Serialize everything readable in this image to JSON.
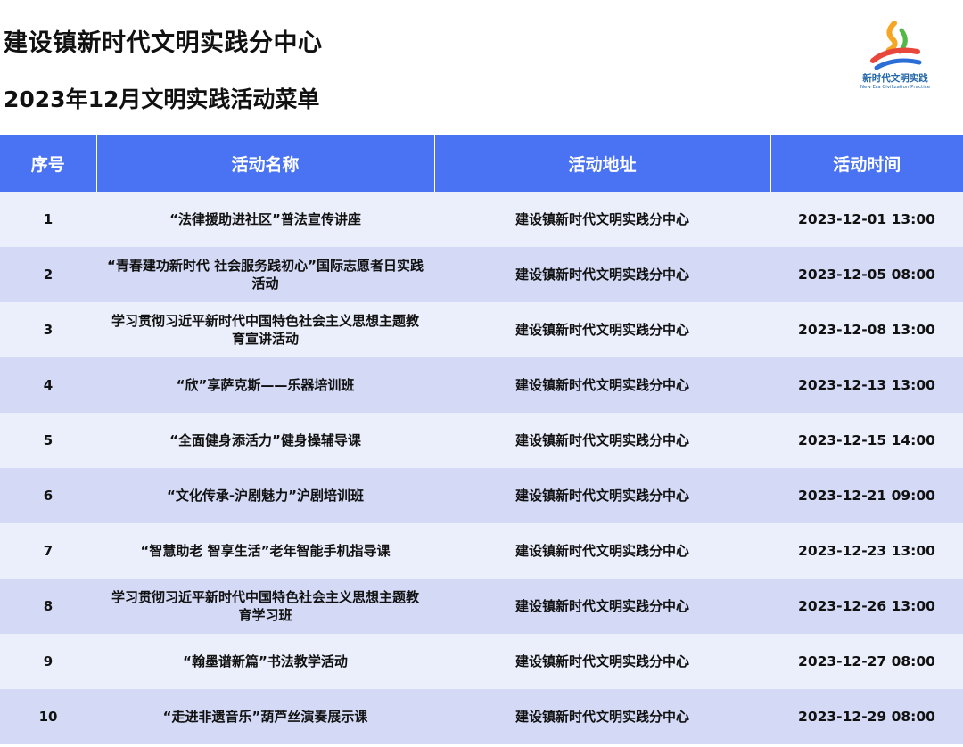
{
  "header": {
    "title": "建设镇新时代文明实践分中心",
    "subtitle": "2023年12月文明实践活动菜单"
  },
  "logo": {
    "text_cn": "新时代文明实践",
    "text_en": "New Era Civilization Practice",
    "colors": {
      "orange": "#f5a623",
      "red": "#e8483b",
      "blue": "#2b6fd6",
      "green": "#53b848"
    }
  },
  "table": {
    "columns": [
      "序号",
      "活动名称",
      "活动地址",
      "活动时间"
    ],
    "rows": [
      {
        "no": "1",
        "name": "“法律援助进社区”普法宣传讲座",
        "address": "建设镇新时代文明实践分中心",
        "time": "2023-12-01 13:00"
      },
      {
        "no": "2",
        "name": "“青春建功新时代 社会服务践初心”国际志愿者日实践活动",
        "address": "建设镇新时代文明实践分中心",
        "time": "2023-12-05 08:00"
      },
      {
        "no": "3",
        "name": "学习贯彻习近平新时代中国特色社会主义思想主题教育宣讲活动",
        "address": "建设镇新时代文明实践分中心",
        "time": "2023-12-08 13:00"
      },
      {
        "no": "4",
        "name": "“欣”享萨克斯——乐器培训班",
        "address": "建设镇新时代文明实践分中心",
        "time": "2023-12-13 13:00"
      },
      {
        "no": "5",
        "name": "“全面健身添活力”健身操辅导课",
        "address": "建设镇新时代文明实践分中心",
        "time": "2023-12-15 14:00"
      },
      {
        "no": "6",
        "name": "“文化传承-沪剧魅力”沪剧培训班",
        "address": "建设镇新时代文明实践分中心",
        "time": "2023-12-21 09:00"
      },
      {
        "no": "7",
        "name": "“智慧助老 智享生活”老年智能手机指导课",
        "address": "建设镇新时代文明实践分中心",
        "time": "2023-12-23 13:00"
      },
      {
        "no": "8",
        "name": "学习贯彻习近平新时代中国特色社会主义思想主题教育学习班",
        "address": "建设镇新时代文明实践分中心",
        "time": "2023-12-26 13:00"
      },
      {
        "no": "9",
        "name": "“翰墨谱新篇”书法教学活动",
        "address": "建设镇新时代文明实践分中心",
        "time": "2023-12-27 08:00"
      },
      {
        "no": "10",
        "name": "“走进非遗音乐”葫芦丝演奏展示课",
        "address": "建设镇新时代文明实践分中心",
        "time": "2023-12-29 08:00"
      }
    ]
  }
}
